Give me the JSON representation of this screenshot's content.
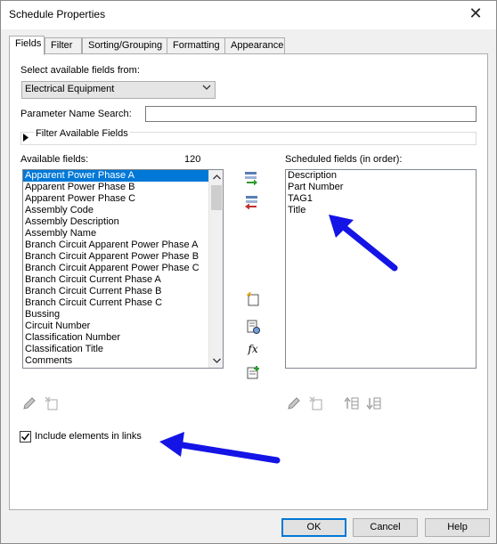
{
  "window": {
    "title": "Schedule Properties",
    "close": "✕"
  },
  "tabs": [
    {
      "label": "Fields"
    },
    {
      "label": "Filter"
    },
    {
      "label": "Sorting/Grouping"
    },
    {
      "label": "Formatting"
    },
    {
      "label": "Appearance"
    }
  ],
  "fields": {
    "select_from_label": "Select available fields from:",
    "select_from_value": "Electrical Equipment",
    "param_search_label": "Parameter Name Search:",
    "param_search_value": "",
    "filter_fields_label": "Filter Available Fields",
    "available_label": "Available fields:",
    "available_count": "120",
    "available_items": [
      "Apparent Power Phase A",
      "Apparent Power Phase B",
      "Apparent Power Phase C",
      "Assembly Code",
      "Assembly Description",
      "Assembly Name",
      "Branch Circuit Apparent Power Phase A",
      "Branch Circuit Apparent Power Phase B",
      "Branch Circuit Apparent Power Phase C",
      "Branch Circuit Current Phase A",
      "Branch Circuit Current Phase B",
      "Branch Circuit Current Phase C",
      "Bussing",
      "Circuit Number",
      "Classification Number",
      "Classification Title",
      "Comments"
    ],
    "scheduled_label": "Scheduled fields (in order):",
    "scheduled_items": [
      "Description",
      "Part Number",
      "TAG1",
      "Title"
    ],
    "include_links_label": "Include elements in links",
    "include_links_checked": true,
    "fx_label": "fx"
  },
  "buttons": {
    "ok": "OK",
    "cancel": "Cancel",
    "help": "Help"
  },
  "colors": {
    "selection": "#0078d7",
    "annotation_arrow": "#1414e6"
  }
}
